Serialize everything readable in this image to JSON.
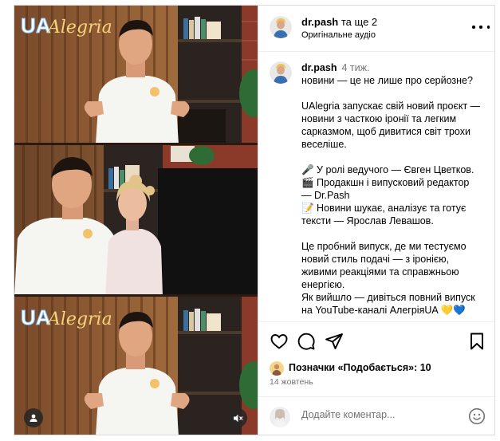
{
  "media": {
    "logo_ua": "UA",
    "logo_script": "Alegria"
  },
  "header": {
    "username": "dr.pash",
    "collab": "та ще 2",
    "audio": "Оригінальне аудіо"
  },
  "caption": {
    "username": "dr.pash",
    "time": "4 тиж.",
    "lines": [
      "новини — це не лише про серйозне?",
      "",
      "UAlegria запускає свій новий проєкт —",
      "новини з часткою іронії та легким",
      "сарказмом, щоб дивитися світ трохи",
      "веселіше.",
      "",
      "🎤 У ролі ведучого — Євген Цветков.",
      "🎬 Продакшн і випусковий редактор",
      "— Dr.Pash",
      "📝 Новини шукає, аналізує та готує",
      "тексти — Ярослав Левашов.",
      "",
      "Це пробний випуск, де ми тестуємо",
      "новий стиль подачі — з іронією,",
      "живими реакціями та справжньою",
      "енергією.",
      "Як вийшло — дивіться повний випуск",
      "на YouTube-каналі АлегріяUA 💛💙"
    ]
  },
  "likes": {
    "label": "Позначки «Подобається»:",
    "count": "10"
  },
  "date": "14 жовтень",
  "comment": {
    "placeholder": "Додайте коментар..."
  },
  "colors": {
    "accent_gold": "#f2c26b",
    "muted_text": "#737373",
    "border": "#dbdbdb"
  },
  "icons": [
    "heart-icon",
    "comment-icon",
    "share-icon",
    "bookmark-icon",
    "more-icon",
    "emoji-icon",
    "user-icon",
    "mute-icon"
  ]
}
